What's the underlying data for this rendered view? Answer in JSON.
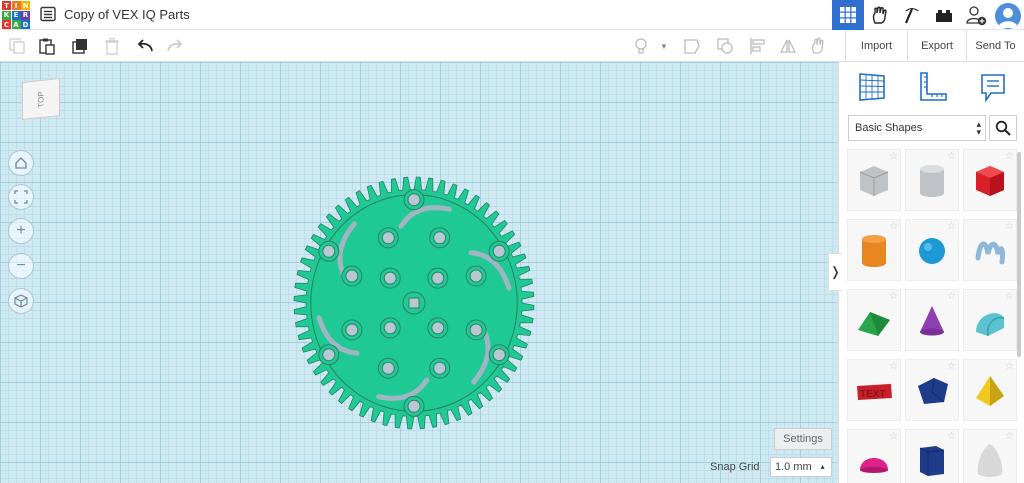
{
  "app": {
    "logo_letters": [
      "T",
      "I",
      "N",
      "K",
      "E",
      "R",
      "C",
      "A",
      "D"
    ],
    "logo_colors": [
      "#e2352b",
      "#e87c1e",
      "#f4b400",
      "#3aa845",
      "#1a6fc7",
      "#6b3fa0",
      "#e2352b",
      "#3aa845",
      "#1a6fc7"
    ],
    "document_title": "Copy of VEX IQ Parts"
  },
  "topbar": {
    "icons": [
      "grid-view-icon",
      "tinker-hand-icon",
      "pickaxe-icon",
      "bricks-icon",
      "add-user-icon",
      "account-avatar"
    ],
    "accent_color": "#2f6fd0"
  },
  "toolbar": {
    "import_label": "Import",
    "export_label": "Export",
    "send_to_label": "Send To"
  },
  "viewport": {
    "viewcube_label": "TOP",
    "settings_label": "Settings",
    "snap_grid_label": "Snap Grid",
    "snap_grid_value": "1.0 mm",
    "gear_color": "#1fc994",
    "gear_teeth": 60
  },
  "panel": {
    "category": "Basic Shapes",
    "shapes": [
      {
        "name": "box-hole",
        "color": "#bfc3c8"
      },
      {
        "name": "cylinder-hole",
        "color": "#bfc3c8"
      },
      {
        "name": "box",
        "color": "#d8202a"
      },
      {
        "name": "cylinder",
        "color": "#e8861f"
      },
      {
        "name": "sphere",
        "color": "#1d9ad6"
      },
      {
        "name": "scribble",
        "color": "#8fb7d8"
      },
      {
        "name": "roof",
        "color": "#2aa64a"
      },
      {
        "name": "cone",
        "color": "#8e3fb0"
      },
      {
        "name": "round-roof",
        "color": "#5bc3cf"
      },
      {
        "name": "text",
        "color": "#c8202a"
      },
      {
        "name": "polygon",
        "color": "#1f3c8a"
      },
      {
        "name": "pyramid",
        "color": "#f0c81e"
      },
      {
        "name": "half-sphere",
        "color": "#e0218a"
      },
      {
        "name": "hexagonal-prism",
        "color": "#1f3c8a"
      },
      {
        "name": "paraboloid",
        "color": "#d8d8d8"
      }
    ]
  }
}
